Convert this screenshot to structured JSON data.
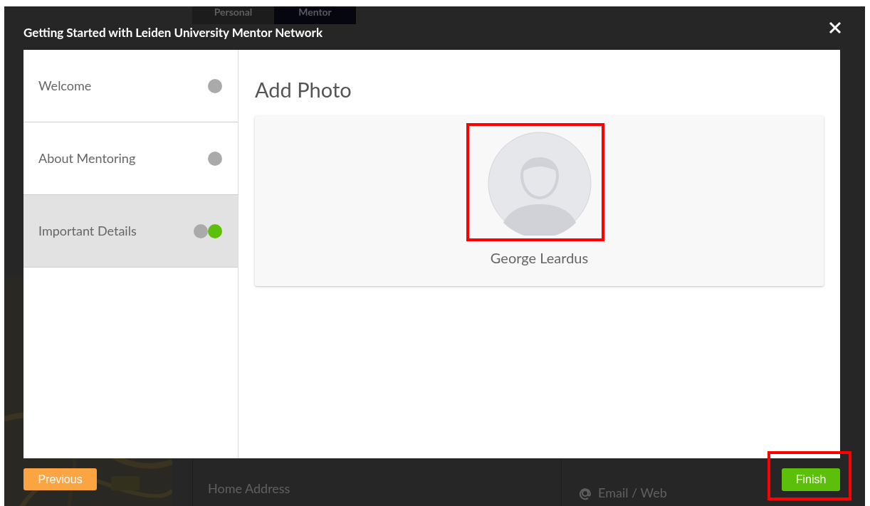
{
  "background_page": {
    "tabs": [
      {
        "label": "Personal",
        "selected": false
      },
      {
        "label": "Mentor",
        "selected": true
      }
    ],
    "sections": [
      {
        "kind": "address",
        "label": "Home Address"
      },
      {
        "kind": "email",
        "label": "Email / Web"
      }
    ]
  },
  "dialog": {
    "title": "Getting Started with Leiden University Mentor Network",
    "steps": [
      {
        "label": "Welcome",
        "selected": false,
        "dots": [
          {
            "color": "#aaaaaa"
          }
        ]
      },
      {
        "label": "About Mentoring",
        "selected": false,
        "dots": [
          {
            "color": "#aaaaaa"
          }
        ]
      },
      {
        "label": "Important Details",
        "selected": true,
        "dots": [
          {
            "color": "#aaaaaa"
          },
          {
            "color": "#5cbf0a"
          }
        ]
      }
    ],
    "heading": "Add Photo",
    "profile_name": "George Leardus",
    "avatar_highlighted": true,
    "previous_button": "Previous",
    "finish_button": "Finish",
    "finish_highlighted": true
  }
}
